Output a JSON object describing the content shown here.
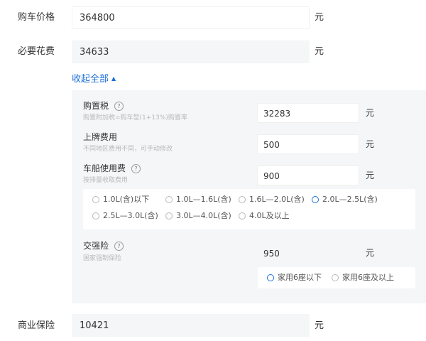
{
  "form": {
    "car_price": {
      "label": "购车价格",
      "value": "364800",
      "unit": "元"
    },
    "required_cost": {
      "label": "必要花费",
      "value": "34633",
      "unit": "元"
    },
    "collapse_label": "收起全部",
    "purchase_tax": {
      "title": "购置税",
      "hint": "购置附加税=购车型(1+13%)购置率",
      "value": "32283",
      "unit": "元"
    },
    "license_fee": {
      "title": "上牌费用",
      "hint": "不同地区费用不同，可手动修改",
      "value": "500",
      "unit": "元"
    },
    "vehicle_tax": {
      "title": "车船使用费",
      "hint": "按排量收取费用",
      "value": "900",
      "unit": "元",
      "options": [
        "1.0L(含)以下",
        "1.0L—1.6L(含)",
        "1.6L—2.0L(含)",
        "2.0L—2.5L(含)",
        "2.5L—3.0L(含)",
        "3.0L—4.0L(含)",
        "4.0L及以上"
      ],
      "selected": "2.0L—2.5L(含)"
    },
    "compulsory_insurance": {
      "title": "交强险",
      "hint": "国家强制保险",
      "value": "950",
      "unit": "元",
      "options": [
        "家用6座以下",
        "家用6座及以上"
      ],
      "selected": "家用6座以下"
    },
    "commercial_insurance": {
      "label": "商业保险",
      "value": "10421",
      "unit": "元"
    }
  },
  "colors": {
    "accent": "#1a6ed8",
    "panel_bg": "#f5f6f7",
    "hint_text": "#b6b9bd"
  },
  "icons": {
    "help": "question-circle-icon",
    "collapse": "caret-up-icon",
    "radio": "radio-circle-icon"
  }
}
